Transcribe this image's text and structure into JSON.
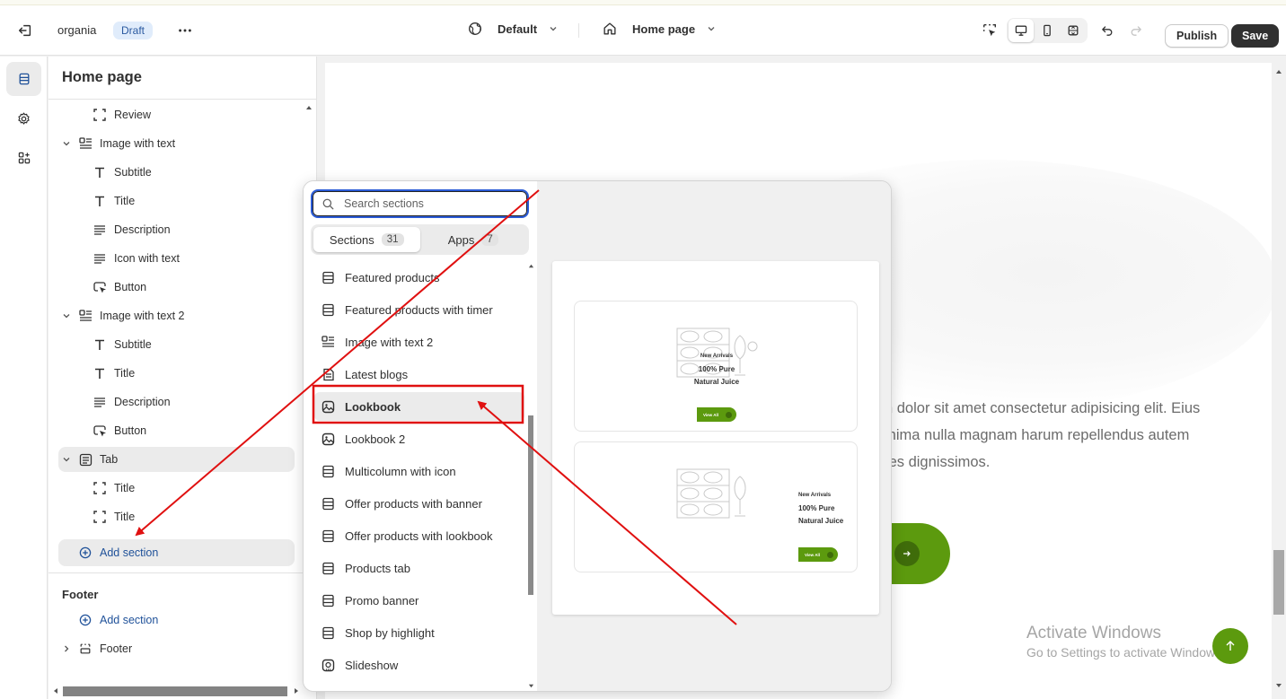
{
  "topbar": {
    "store_name": "organia",
    "status_badge": "Draft",
    "theme": "Default",
    "page": "Home page",
    "publish_label": "Publish",
    "save_label": "Save"
  },
  "sidebar": {
    "title": "Home page",
    "tree": [
      {
        "label": "Review",
        "icon": "block-dashed-icon",
        "level": 2
      },
      {
        "label": "Image with text",
        "icon": "image-text-icon",
        "level": 1,
        "expanded": true
      },
      {
        "label": "Subtitle",
        "icon": "text-T-icon",
        "level": 2
      },
      {
        "label": "Title",
        "icon": "text-T-icon",
        "level": 2
      },
      {
        "label": "Description",
        "icon": "paragraph-icon",
        "level": 2
      },
      {
        "label": "Icon with text",
        "icon": "paragraph-icon",
        "level": 2
      },
      {
        "label": "Button",
        "icon": "button-cursor-icon",
        "level": 2
      },
      {
        "label": "Image with text 2",
        "icon": "image-text-icon",
        "level": 1,
        "expanded": true
      },
      {
        "label": "Subtitle",
        "icon": "text-T-icon",
        "level": 2
      },
      {
        "label": "Title",
        "icon": "text-T-icon",
        "level": 2
      },
      {
        "label": "Description",
        "icon": "paragraph-icon",
        "level": 2
      },
      {
        "label": "Button",
        "icon": "button-cursor-icon",
        "level": 2
      },
      {
        "label": "Tab",
        "icon": "tab-icon",
        "level": 1,
        "expanded": true,
        "selected": true
      },
      {
        "label": "Title",
        "icon": "block-dashed-icon",
        "level": 2
      },
      {
        "label": "Title",
        "icon": "block-dashed-icon",
        "level": 2
      }
    ],
    "add_section_label": "Add section",
    "footer_heading": "Footer",
    "footer_add_section_label": "Add section",
    "footer_item_label": "Footer"
  },
  "picker": {
    "search_placeholder": "Search sections",
    "tabs": [
      {
        "label": "Sections",
        "count": "31",
        "active": true
      },
      {
        "label": "Apps",
        "count": "7",
        "active": false
      }
    ],
    "items": [
      {
        "label": "Featured products",
        "icon": "section-icon"
      },
      {
        "label": "Featured products with timer",
        "icon": "section-icon"
      },
      {
        "label": "Image with text 2",
        "icon": "image-text-icon"
      },
      {
        "label": "Latest blogs",
        "icon": "blog-icon"
      },
      {
        "label": "Lookbook",
        "icon": "image-icon",
        "highlighted": true
      },
      {
        "label": "Lookbook 2",
        "icon": "image-icon"
      },
      {
        "label": "Multicolumn with icon",
        "icon": "section-icon"
      },
      {
        "label": "Offer products with banner",
        "icon": "section-icon"
      },
      {
        "label": "Offer products with lookbook",
        "icon": "section-icon"
      },
      {
        "label": "Products tab",
        "icon": "section-icon"
      },
      {
        "label": "Promo banner",
        "icon": "section-icon"
      },
      {
        "label": "Shop by highlight",
        "icon": "section-icon"
      },
      {
        "label": "Slideshow",
        "icon": "slideshow-icon"
      }
    ],
    "preview": {
      "cards": [
        {
          "tag": "New Arrivals",
          "line1": "100% Pure",
          "line2": "Natural Juice",
          "button": "View All"
        },
        {
          "tag": "New Arrivals",
          "line1": "100% Pure",
          "line2": "Natural Juice",
          "button": "View All"
        }
      ]
    }
  },
  "preview_page": {
    "paragraph_lines": [
      "n dolor sit amet consectetur adipisicing elit. Eius",
      "inima nulla magnam harum repellendus autem",
      "tes dignissimos."
    ],
    "watermark_title": "Activate Windows",
    "watermark_sub": "Go to Settings to activate Windows."
  },
  "colors": {
    "accent_green": "#5c9a0e",
    "annotation_red": "#e01010",
    "focus_blue": "#2a5bd7",
    "link_blue": "#1f5199"
  }
}
